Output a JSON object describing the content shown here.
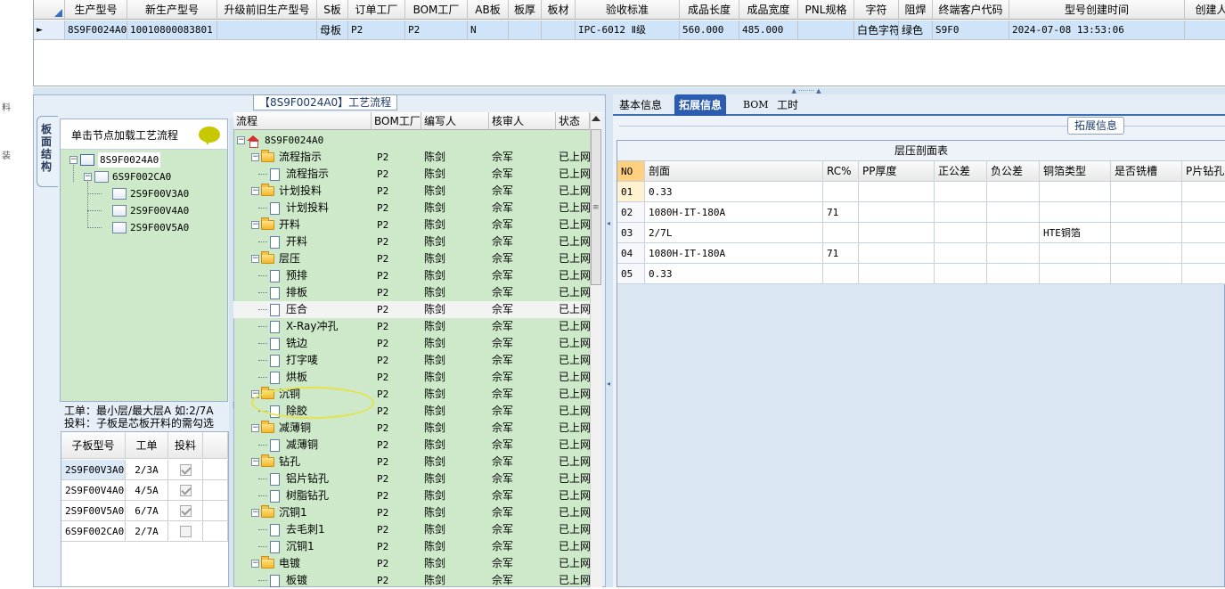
{
  "top_grid": {
    "columns": [
      "生产型号",
      "新生产型号",
      "升级前旧生产型号",
      "S板",
      "订单工厂",
      "BOM工厂",
      "AB板",
      "板厚",
      "板材",
      "验收标准",
      "成品长度",
      "成品宽度",
      "PNL规格",
      "字符",
      "阻焊",
      "终端客户代码",
      "型号创建时间",
      "创建人"
    ],
    "row": [
      "8S9F0024A0",
      "10010800083801",
      "",
      "母板",
      "P2",
      "P2",
      "N",
      "",
      "",
      "IPC-6012 Ⅱ级",
      "560.000",
      "485.000",
      "",
      "白色字符",
      "绿色",
      "S9F0",
      "2024-07-08 13:53:06",
      ""
    ],
    "row_pointer": "►"
  },
  "far_left": [
    "料",
    "装"
  ],
  "process_title": "【8S9F0024A0】工艺流程",
  "vertical_tab": "板面结构",
  "structure": {
    "load_label": "单击节点加载工艺流程",
    "nodes": [
      "8S9F0024A0",
      "6S9F002CA0",
      "2S9F00V3A0",
      "2S9F00V4A0",
      "2S9F00V5A0"
    ]
  },
  "hint": {
    "line1": "工单：最小层/最大层A 如:2/7A",
    "line2": "投料：子板是芯板开料的需勾选"
  },
  "sub_table": {
    "headers": [
      "子板型号",
      "工单",
      "投料"
    ],
    "rows": [
      {
        "model": "2S9F00V3A0",
        "order": "2/3A",
        "checked": true
      },
      {
        "model": "2S9F00V4A0",
        "order": "4/5A",
        "checked": true
      },
      {
        "model": "2S9F00V5A0",
        "order": "6/7A",
        "checked": true
      },
      {
        "model": "6S9F002CA0",
        "order": "2/7A",
        "checked": false
      }
    ]
  },
  "process_grid": {
    "headers": [
      "流程",
      "BOM工厂",
      "编写人",
      "核审人",
      "状态"
    ],
    "root": "8S9F0024A0",
    "rows": [
      {
        "level": "group",
        "name": "流程指示",
        "bom": "P2",
        "writer": "陈剑",
        "reviewer": "佘军",
        "status": "已上网"
      },
      {
        "level": "item",
        "name": "流程指示",
        "bom": "P2",
        "writer": "陈剑",
        "reviewer": "佘军",
        "status": "已上网"
      },
      {
        "level": "group",
        "name": "计划投料",
        "bom": "P2",
        "writer": "陈剑",
        "reviewer": "佘军",
        "status": "已上网"
      },
      {
        "level": "item",
        "name": "计划投料",
        "bom": "P2",
        "writer": "陈剑",
        "reviewer": "佘军",
        "status": "已上网"
      },
      {
        "level": "group",
        "name": "开料",
        "bom": "P2",
        "writer": "陈剑",
        "reviewer": "佘军",
        "status": "已上网"
      },
      {
        "level": "item",
        "name": "开料",
        "bom": "P2",
        "writer": "陈剑",
        "reviewer": "佘军",
        "status": "已上网"
      },
      {
        "level": "group",
        "name": "层压",
        "bom": "P2",
        "writer": "陈剑",
        "reviewer": "佘军",
        "status": "已上网"
      },
      {
        "level": "item",
        "name": "预排",
        "bom": "P2",
        "writer": "陈剑",
        "reviewer": "佘军",
        "status": "已上网"
      },
      {
        "level": "item",
        "name": "排板",
        "bom": "P2",
        "writer": "陈剑",
        "reviewer": "佘军",
        "status": "已上网"
      },
      {
        "level": "item",
        "name": "压合",
        "bom": "P2",
        "writer": "陈剑",
        "reviewer": "佘军",
        "status": "已上网"
      },
      {
        "level": "item",
        "name": "X-Ray冲孔",
        "bom": "P2",
        "writer": "陈剑",
        "reviewer": "佘军",
        "status": "已上网"
      },
      {
        "level": "item",
        "name": "铣边",
        "bom": "P2",
        "writer": "陈剑",
        "reviewer": "佘军",
        "status": "已上网"
      },
      {
        "level": "item",
        "name": "打字唛",
        "bom": "P2",
        "writer": "陈剑",
        "reviewer": "佘军",
        "status": "已上网"
      },
      {
        "level": "item",
        "name": "烘板",
        "bom": "P2",
        "writer": "陈剑",
        "reviewer": "佘军",
        "status": "已上网"
      },
      {
        "level": "group",
        "name": "沉铜",
        "bom": "P2",
        "writer": "陈剑",
        "reviewer": "佘军",
        "status": "已上网"
      },
      {
        "level": "item",
        "name": "除胶",
        "bom": "P2",
        "writer": "陈剑",
        "reviewer": "佘军",
        "status": "已上网"
      },
      {
        "level": "group",
        "name": "减薄铜",
        "bom": "P2",
        "writer": "陈剑",
        "reviewer": "佘军",
        "status": "已上网"
      },
      {
        "level": "item",
        "name": "减薄铜",
        "bom": "P2",
        "writer": "陈剑",
        "reviewer": "佘军",
        "status": "已上网"
      },
      {
        "level": "group",
        "name": "钻孔",
        "bom": "P2",
        "writer": "陈剑",
        "reviewer": "佘军",
        "status": "已上网"
      },
      {
        "level": "item",
        "name": "铝片钻孔",
        "bom": "P2",
        "writer": "陈剑",
        "reviewer": "佘军",
        "status": "已上网"
      },
      {
        "level": "item",
        "name": "树脂钻孔",
        "bom": "P2",
        "writer": "陈剑",
        "reviewer": "佘军",
        "status": "已上网"
      },
      {
        "level": "group",
        "name": "沉铜1",
        "bom": "P2",
        "writer": "陈剑",
        "reviewer": "佘军",
        "status": "已上网"
      },
      {
        "level": "item",
        "name": "去毛刺1",
        "bom": "P2",
        "writer": "陈剑",
        "reviewer": "佘军",
        "status": "已上网"
      },
      {
        "level": "item",
        "name": "沉铜1",
        "bom": "P2",
        "writer": "陈剑",
        "reviewer": "佘军",
        "status": "已上网"
      },
      {
        "level": "group",
        "name": "电镀",
        "bom": "P2",
        "writer": "陈剑",
        "reviewer": "佘军",
        "status": "已上网"
      },
      {
        "level": "item",
        "name": "板镀",
        "bom": "P2",
        "writer": "陈剑",
        "reviewer": "佘军",
        "status": "已上网"
      }
    ],
    "selected_index": 9
  },
  "right_tabs": [
    "基本信息",
    "拓展信息",
    "BOM",
    "工时"
  ],
  "right_active_tab": 1,
  "ext_title": "拓展信息",
  "lamination": {
    "title": "层压剖面表",
    "headers": [
      "NO",
      "剖面",
      "RC%",
      "PP厚度",
      "正公差",
      "负公差",
      "铜箔类型",
      "是否铣槽",
      "P片钻孔"
    ],
    "rows": [
      [
        "01",
        "0.33",
        "",
        "",
        "",
        "",
        "",
        "",
        ""
      ],
      [
        "02",
        "1080H-IT-180A",
        "71",
        "",
        "",
        "",
        "",
        "",
        ""
      ],
      [
        "03",
        "2/7L",
        "",
        "",
        "",
        "",
        "HTE铜箔",
        "",
        ""
      ],
      [
        "04",
        "1080H-IT-180A",
        "71",
        "",
        "",
        "",
        "",
        "",
        ""
      ],
      [
        "05",
        "0.33",
        "",
        "",
        "",
        "",
        "",
        "",
        ""
      ]
    ]
  }
}
